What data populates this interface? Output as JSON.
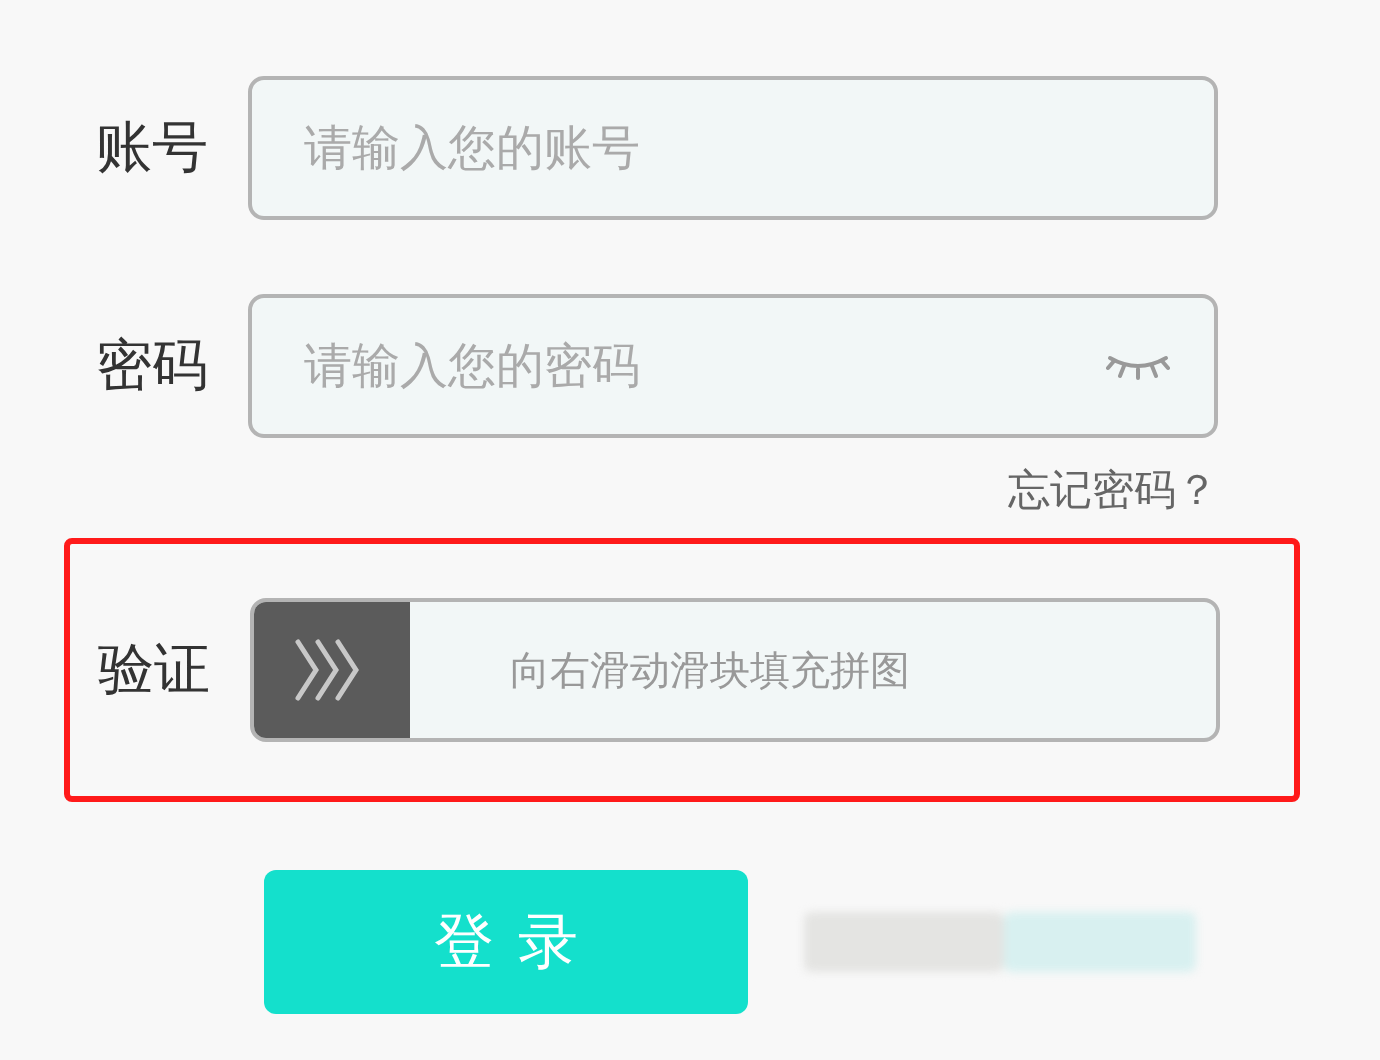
{
  "account": {
    "label": "账号",
    "placeholder": "请输入您的账号"
  },
  "password": {
    "label": "密码",
    "placeholder": "请输入您的密码"
  },
  "forgot_link": "忘记密码？",
  "verify": {
    "label": "验证",
    "hint": "向右滑动滑块填充拼图",
    "level": 0,
    "highlighted": true
  },
  "login_button": "登录"
}
